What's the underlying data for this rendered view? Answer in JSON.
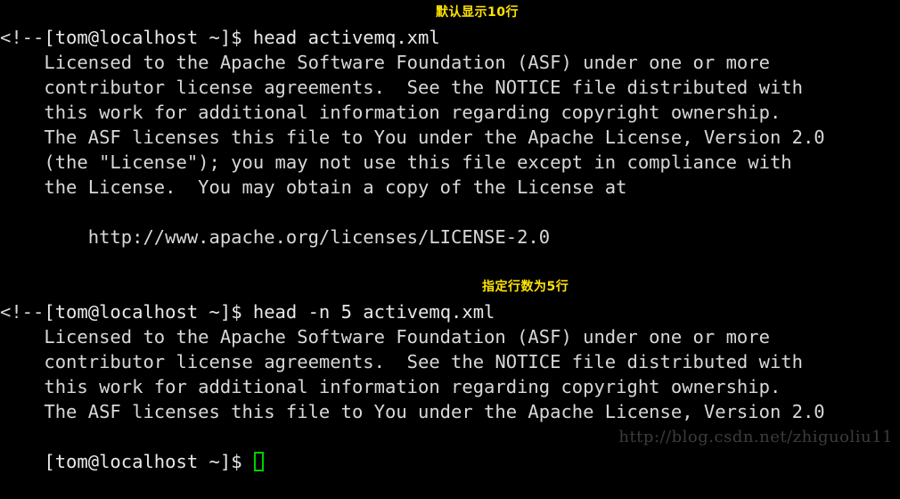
{
  "terminal": {
    "background_color": "#000000",
    "foreground_color": "#d8d8d8",
    "annotation_color": "#ffe400",
    "cursor_color": "#00d000",
    "watermark_color": "#3c3c3c",
    "prompt": "[tom@localhost ~]$ ",
    "lines": [
      {
        "type": "prompt",
        "prompt": "[tom@localhost ~]$ ",
        "command": "head activemq.xml",
        "annotation": "默认显示10行"
      },
      {
        "type": "output",
        "text": "<!--"
      },
      {
        "type": "output",
        "text": "    Licensed to the Apache Software Foundation (ASF) under one or more"
      },
      {
        "type": "output",
        "text": "    contributor license agreements.  See the NOTICE file distributed with"
      },
      {
        "type": "output",
        "text": "    this work for additional information regarding copyright ownership."
      },
      {
        "type": "output",
        "text": "    The ASF licenses this file to You under the Apache License, Version 2.0"
      },
      {
        "type": "output",
        "text": "    (the \"License\"); you may not use this file except in compliance with"
      },
      {
        "type": "output",
        "text": "    the License.  You may obtain a copy of the License at"
      },
      {
        "type": "output",
        "text": ""
      },
      {
        "type": "output",
        "text": "        http://www.apache.org/licenses/LICENSE-2.0"
      },
      {
        "type": "output",
        "text": ""
      },
      {
        "type": "prompt",
        "prompt": "[tom@localhost ~]$ ",
        "command": "head -n 5 activemq.xml",
        "annotation": "指定行数为5行"
      },
      {
        "type": "output",
        "text": "<!--"
      },
      {
        "type": "output",
        "text": "    Licensed to the Apache Software Foundation (ASF) under one or more"
      },
      {
        "type": "output",
        "text": "    contributor license agreements.  See the NOTICE file distributed with"
      },
      {
        "type": "output",
        "text": "    this work for additional information regarding copyright ownership."
      },
      {
        "type": "output",
        "text": "    The ASF licenses this file to You under the Apache License, Version 2.0"
      },
      {
        "type": "prompt_cursor",
        "prompt": "[tom@localhost ~]$ "
      }
    ],
    "watermark": "http://blog.csdn.net/zhiguoliu11"
  }
}
